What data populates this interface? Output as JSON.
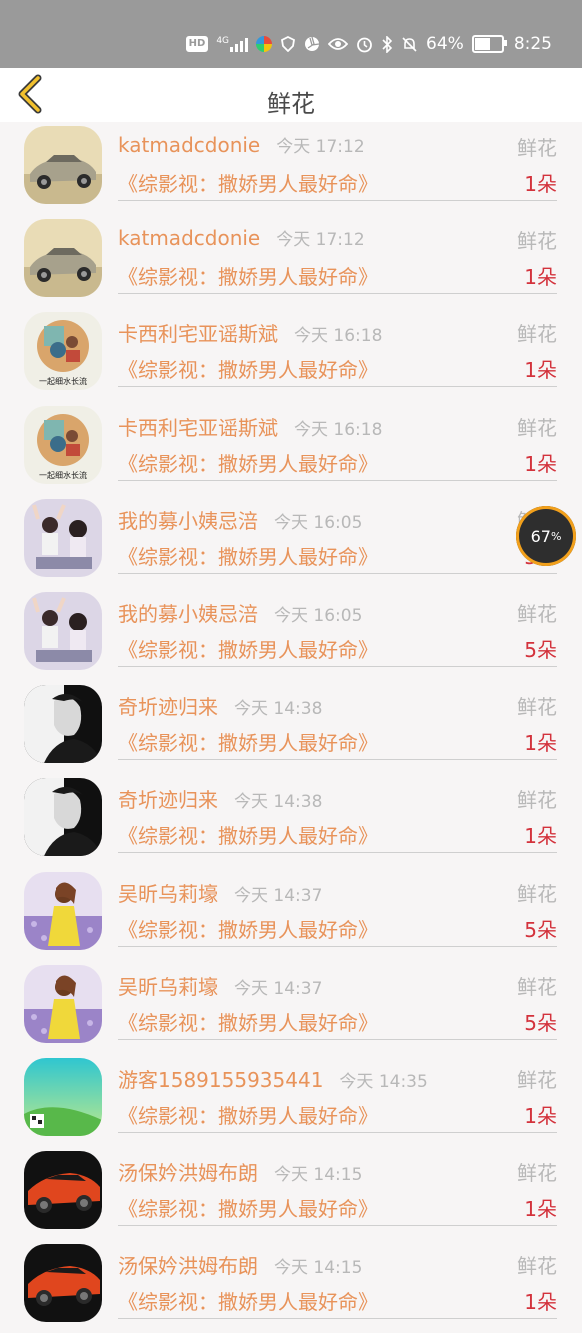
{
  "status_bar": {
    "hd": "HD",
    "network": "4G",
    "battery_pct": "64%",
    "battery_level": 0.64,
    "time": "8:25"
  },
  "header": {
    "title": "鲜花"
  },
  "float_widget": {
    "value": "67",
    "unit": "%"
  },
  "items": [
    {
      "name": "katmadcdonie",
      "time": "今天 17:12",
      "label": "鲜花",
      "book": "《综影视：撒娇男人最好命》",
      "count": "1朵",
      "avatar": "car-gold"
    },
    {
      "name": "katmadcdonie",
      "time": "今天 17:12",
      "label": "鲜花",
      "book": "《综影视：撒娇男人最好命》",
      "count": "1朵",
      "avatar": "car-gold"
    },
    {
      "name": "卡西利宅亚谣斯斌",
      "time": "今天 16:18",
      "label": "鲜花",
      "book": "《综影视：撒娇男人最好命》",
      "count": "1朵",
      "avatar": "painting",
      "avatar_text": "一起细水长流"
    },
    {
      "name": "卡西利宅亚谣斯斌",
      "time": "今天 16:18",
      "label": "鲜花",
      "book": "《综影视：撒娇男人最好命》",
      "count": "1朵",
      "avatar": "painting",
      "avatar_text": "一起细水长流"
    },
    {
      "name": "我的募小姨忌涪",
      "time": "今天 16:05",
      "label": "鲜花",
      "book": "《综影视：撒娇男人最好命》",
      "count": "5朵",
      "avatar": "couple"
    },
    {
      "name": "我的募小姨忌涪",
      "time": "今天 16:05",
      "label": "鲜花",
      "book": "《综影视：撒娇男人最好命》",
      "count": "5朵",
      "avatar": "couple"
    },
    {
      "name": "奇圻迹归来",
      "time": "今天 14:38",
      "label": "鲜花",
      "book": "《综影视：撒娇男人最好命》",
      "count": "1朵",
      "avatar": "portrait-bw"
    },
    {
      "name": "奇圻迹归来",
      "time": "今天 14:38",
      "label": "鲜花",
      "book": "《综影视：撒娇男人最好命》",
      "count": "1朵",
      "avatar": "portrait-bw"
    },
    {
      "name": "吴昕乌莉壕",
      "time": "今天 14:37",
      "label": "鲜花",
      "book": "《综影视：撒娇男人最好命》",
      "count": "5朵",
      "avatar": "lavender-girl"
    },
    {
      "name": "吴昕乌莉壕",
      "time": "今天 14:37",
      "label": "鲜花",
      "book": "《综影视：撒娇男人最好命》",
      "count": "5朵",
      "avatar": "lavender-girl"
    },
    {
      "name": "游客1589155935441",
      "time": "今天 14:35",
      "label": "鲜花",
      "book": "《综影视：撒娇男人最好命》",
      "count": "1朵",
      "avatar": "teal-default"
    },
    {
      "name": "汤保妗洪姆布朗",
      "time": "今天 14:15",
      "label": "鲜花",
      "book": "《综影视：撒娇男人最好命》",
      "count": "1朵",
      "avatar": "car-orange"
    },
    {
      "name": "汤保妗洪姆布朗",
      "time": "今天 14:15",
      "label": "鲜花",
      "book": "《综影视：撒娇男人最好命》",
      "count": "1朵",
      "avatar": "car-orange"
    }
  ]
}
